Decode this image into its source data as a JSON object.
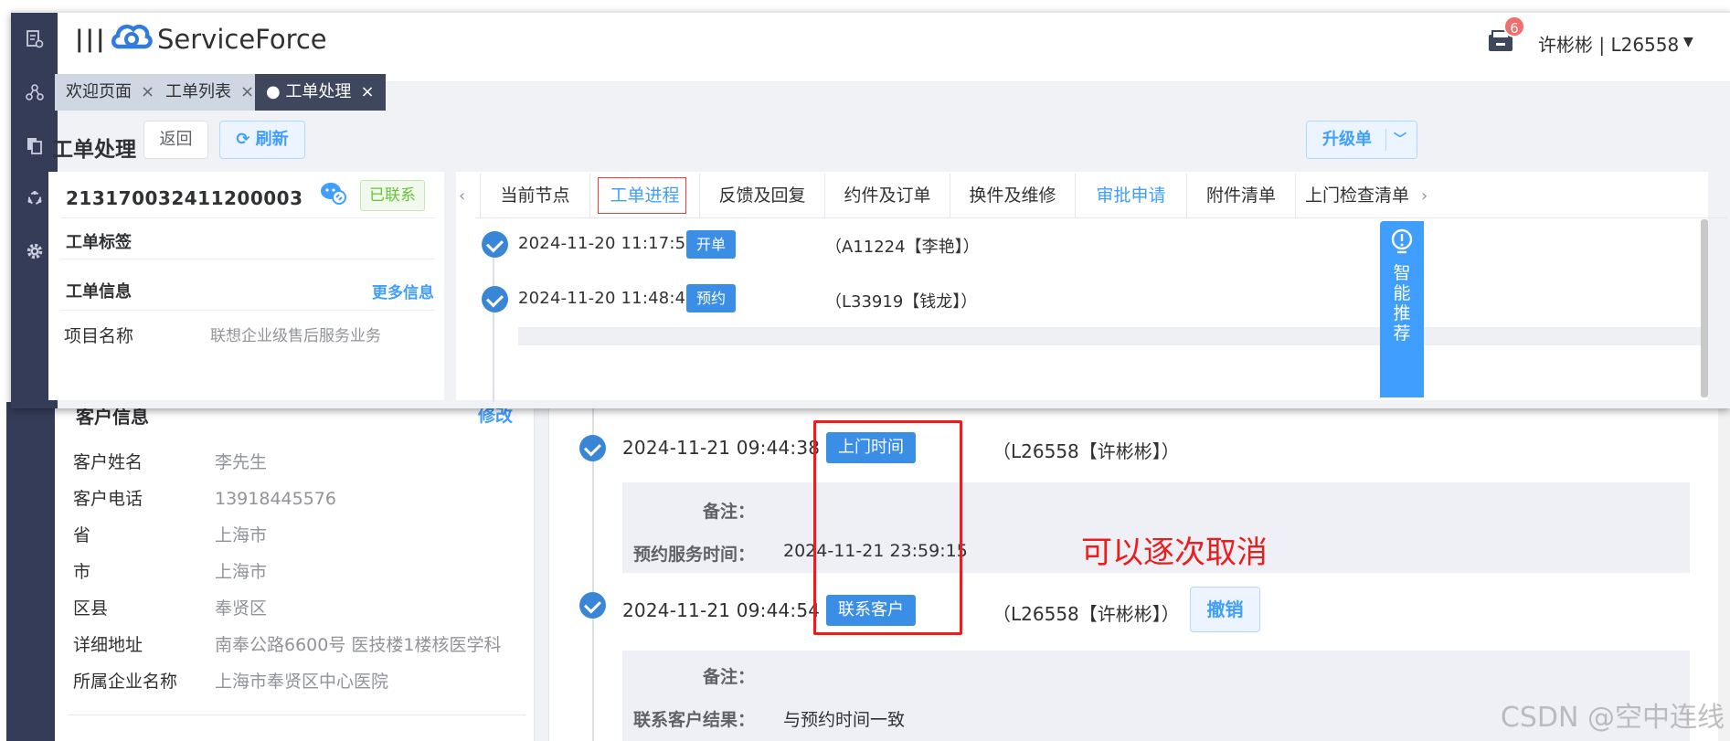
{
  "app": {
    "brand": "ServiceForce",
    "notification_count": "6",
    "user": "许彬彬 | L26558"
  },
  "page_tabs": [
    {
      "label": "欢迎页面",
      "close": "×"
    },
    {
      "label": "工单列表",
      "close": "×"
    },
    {
      "label": "● 工单处理",
      "close": "×"
    }
  ],
  "header": {
    "title": "工单处理",
    "back": "返回",
    "refresh": "⟳ 刷新",
    "upgrade": "升级单",
    "upgrade_caret": "﹀"
  },
  "order": {
    "number": "213170032411200003",
    "status": "已联系",
    "section_tags": "工单标签",
    "section_info": "工单信息",
    "more_info": "更多信息",
    "project_label": "项目名称",
    "project_value": "联想企业级售后服务业务"
  },
  "work_tabs": [
    {
      "label": "当前节点"
    },
    {
      "label": "工单进程"
    },
    {
      "label": "反馈及回复"
    },
    {
      "label": "约件及订单"
    },
    {
      "label": "换件及维修"
    },
    {
      "label": "审批申请"
    },
    {
      "label": "附件清单"
    },
    {
      "label": "上门检查清单"
    }
  ],
  "timeline_top": [
    {
      "time": "2024-11-20 11:17:51",
      "tag": "开单",
      "who": "（A11224【李艳】）"
    },
    {
      "time": "2024-11-20 11:48:48",
      "tag": "预约",
      "who": "（L33919【钱龙】）"
    }
  ],
  "smart_recommend": "智能推荐",
  "customer": {
    "heading": "客户信息",
    "edit": "修改",
    "rows": [
      {
        "k": "客户姓名",
        "v": "李先生"
      },
      {
        "k": "客户电话",
        "v": "13918445576"
      },
      {
        "k": "省",
        "v": "上海市"
      },
      {
        "k": "市",
        "v": "上海市"
      },
      {
        "k": "区县",
        "v": "奉贤区"
      },
      {
        "k": "详细地址",
        "v": "南奉公路6600号 医技楼1楼核医学科"
      },
      {
        "k": "所属企业名称",
        "v": "上海市奉贤区中心医院"
      }
    ]
  },
  "timeline_bottom": [
    {
      "time": "2024-11-21 09:44:38",
      "tag": "上门时间",
      "who": "（L26558【许彬彬】）",
      "notes": [
        {
          "k": "备注：",
          "v": ""
        },
        {
          "k": "预约服务时间：",
          "v": "2024-11-21 23:59:15"
        }
      ]
    },
    {
      "time": "2024-11-21 09:44:54",
      "tag": "联系客户",
      "who": "（L26558【许彬彬】）",
      "action": "撤销",
      "notes": [
        {
          "k": "备注：",
          "v": ""
        },
        {
          "k": "联系客户结果：",
          "v": "与预约时间一致"
        }
      ]
    }
  ],
  "annotation": "可以逐次取消",
  "watermark": "CSDN @空中连线",
  "colors": {
    "primary": "#409eff",
    "rail": "#343c57",
    "annotation": "#ee1c1c",
    "success": "#67c23a"
  }
}
